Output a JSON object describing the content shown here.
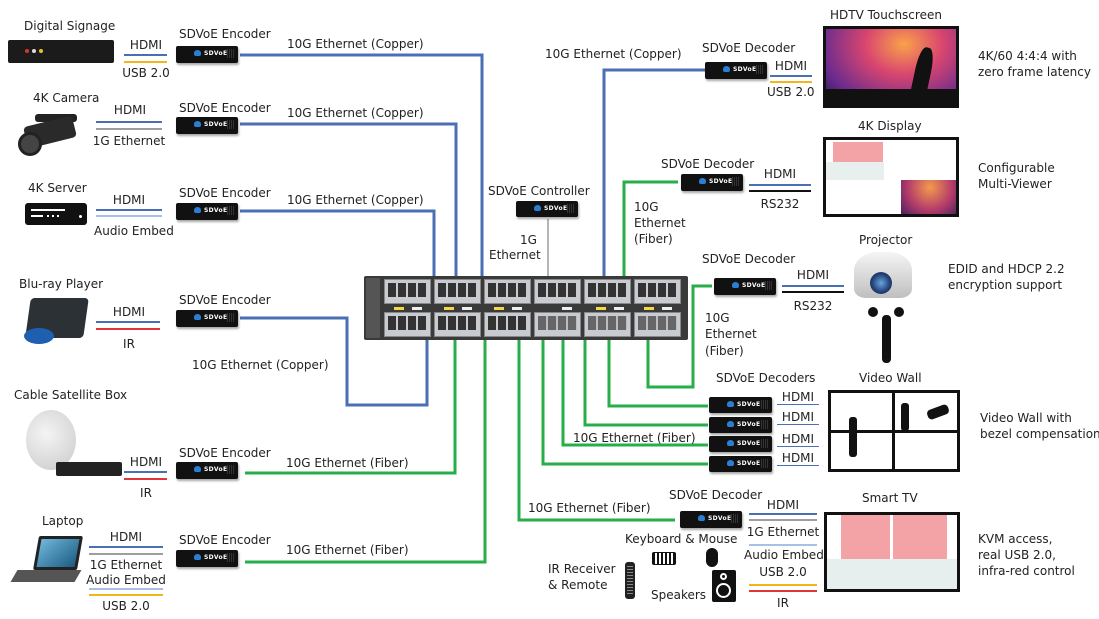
{
  "colors": {
    "hdmi": "#4a6fb5",
    "usb": "#f2b51c",
    "ethernet_1g": "#9e9e9e",
    "audio_embed": "#a9c0e6",
    "ir": "#e0353b",
    "rs232": "#111111",
    "copper_10g": "#4a6fb5",
    "fiber_10g": "#27ae4a",
    "controller_link": "#b5b5b5"
  },
  "sources": [
    {
      "name": "Digital Signage",
      "signals": [
        "HDMI",
        "USB 2.0"
      ],
      "encoder": "SDVoE Encoder",
      "link": "10G Ethernet (Copper)"
    },
    {
      "name": "4K Camera",
      "signals": [
        "HDMI",
        "1G Ethernet"
      ],
      "encoder": "SDVoE Encoder",
      "link": "10G Ethernet (Copper)"
    },
    {
      "name": "4K Server",
      "signals": [
        "HDMI",
        "Audio Embed"
      ],
      "encoder": "SDVoE Encoder",
      "link": "10G Ethernet (Copper)"
    },
    {
      "name": "Blu-ray Player",
      "signals": [
        "HDMI",
        "IR"
      ],
      "encoder": "SDVoE Encoder",
      "link": "10G Ethernet (Copper)"
    },
    {
      "name": "Cable Satellite Box",
      "signals": [
        "HDMI",
        "IR"
      ],
      "encoder": "SDVoE Encoder",
      "link": "10G Ethernet (Fiber)"
    },
    {
      "name": "Laptop",
      "signals": [
        "HDMI",
        "1G Ethernet",
        "Audio Embed",
        "USB 2.0"
      ],
      "encoder": "SDVoE Encoder",
      "link": "10G Ethernet (Fiber)"
    }
  ],
  "controller": {
    "name": "SDVoE Controller",
    "link_line1": "1G",
    "link_line2": "Ethernet"
  },
  "switch": {
    "name": "Network Switch"
  },
  "box_logo": "SDVoE",
  "destinations": [
    {
      "name": "HDTV Touchscreen",
      "decoder": "SDVoE Decoder",
      "link": "10G Ethernet (Copper)",
      "signals": [
        "HDMI",
        "USB 2.0"
      ],
      "feature_line1": "4K/60 4:4:4 with",
      "feature_line2": "zero frame latency"
    },
    {
      "name": "4K Display",
      "decoder": "SDVoE Decoder",
      "link_line1": "10G",
      "link_line2": "Ethernet",
      "link_line3": "(Fiber)",
      "signals": [
        "HDMI",
        "RS232"
      ],
      "feature_line1": "Configurable",
      "feature_line2": "Multi-Viewer"
    },
    {
      "name": "Projector",
      "decoder": "SDVoE Decoder",
      "link_line1": "10G",
      "link_line2": "Ethernet",
      "link_line3": "(Fiber)",
      "signals": [
        "HDMI",
        "RS232"
      ],
      "feature_line1": "EDID and HDCP 2.2",
      "feature_line2": "encryption support"
    },
    {
      "name": "Video Wall",
      "decoder": "SDVoE Decoders",
      "link": "10G Ethernet (Fiber)",
      "signals": [
        "HDMI",
        "HDMI",
        "HDMI",
        "HDMI"
      ],
      "feature_line1": "Video Wall with",
      "feature_line2": "bezel compensation"
    },
    {
      "name": "Smart TV",
      "decoder": "SDVoE Decoder",
      "link": "10G Ethernet (Fiber)",
      "signals": [
        "HDMI",
        "1G Ethernet",
        "Audio Embed",
        "USB 2.0",
        "IR"
      ],
      "feature_line1": "KVM access,",
      "feature_line2": "real USB 2.0,",
      "feature_line3": "infra-red control"
    }
  ],
  "peripherals": {
    "keyboard_mouse": "Keyboard & Mouse",
    "ir_line1": "IR Receiver",
    "ir_line2": "& Remote",
    "speakers": "Speakers"
  }
}
